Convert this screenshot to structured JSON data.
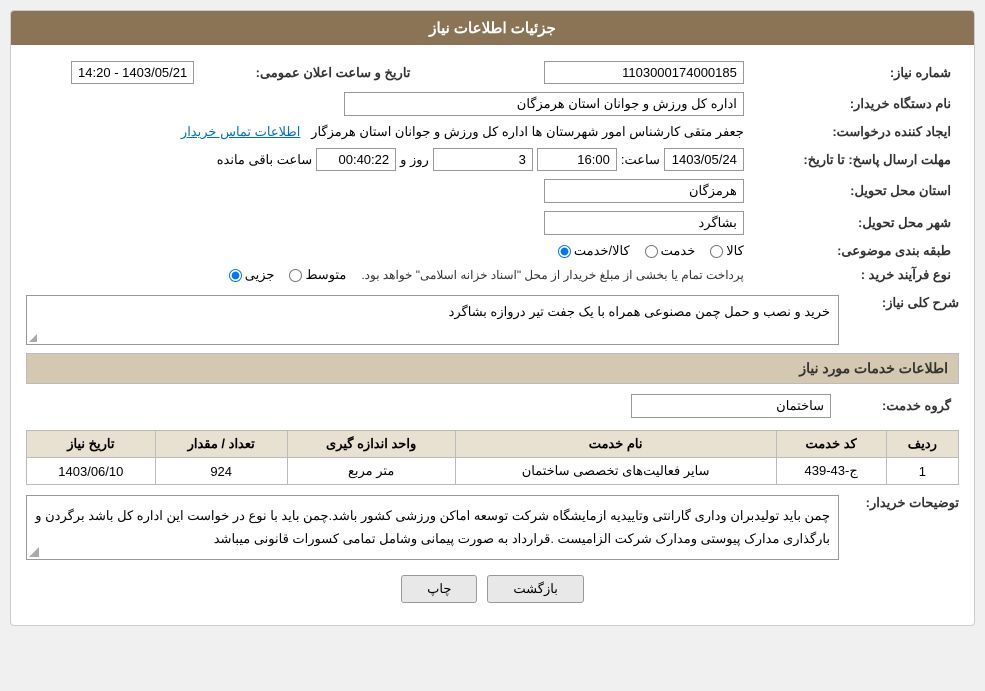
{
  "header": {
    "title": "جزئیات اطلاعات نیاز"
  },
  "fields": {
    "shomareNiaz_label": "شماره نیاز:",
    "shomareNiaz_value": "1103000174000185",
    "namDastgah_label": "نام دستگاه خریدار:",
    "namDastgah_value": "اداره کل ورزش و جوانان استان هرمزگان",
    "ijadKonande_label": "ایجاد کننده درخواست:",
    "ijadKonande_value": "جعفر متقی کارشناس امور شهرستان ها اداره کل ورزش و جوانان استان هرمزگار",
    "ettelaat_link": "اطلاعات تماس خریدار",
    "mohlat_label": "مهلت ارسال پاسخ: تا تاریخ:",
    "mohlat_date": "1403/05/24",
    "mohlat_saat_label": "ساعت:",
    "mohlat_saat": "16:00",
    "mohlat_roz_label": "روز و",
    "mohlat_roz": "3",
    "mohlat_baqi_label": "ساعت باقی مانده",
    "mohlat_baqi": "00:40:22",
    "ostan_label": "استان محل تحویل:",
    "ostan_value": "هرمزگان",
    "shahr_label": "شهر محل تحویل:",
    "shahr_value": "بشاگرد",
    "tabaqe_label": "طبقه بندی موضوعی:",
    "tabaqe_kala": "کالا",
    "tabaqe_khadamat": "خدمت",
    "tabaqe_kala_khadamat": "کالا/خدمت",
    "noe_farayand_label": "نوع فرآیند خرید :",
    "noe_jozi": "جزیی",
    "noe_motevaset": "متوسط",
    "noe_desc": "پرداخت تمام یا بخشی از مبلغ خریدار از محل \"اسناد خزانه اسلامی\" خواهد بود.",
    "sharh_label": "شرح کلی نیاز:",
    "sharh_value": "خرید و نصب و حمل چمن مصنوعی همراه با یک جفت تیر دروازه بشاگرد",
    "section_khadamat": "اطلاعات خدمات مورد نیاز",
    "grohe_khadamat_label": "گروه خدمت:",
    "grohe_khadamat_value": "ساختمان",
    "table_headers": {
      "radif": "ردیف",
      "kod": "کد خدمت",
      "name": "نام خدمت",
      "vahad": "واحد اندازه گیری",
      "tedad": "تعداد / مقدار",
      "tarikh": "تاریخ نیاز"
    },
    "table_rows": [
      {
        "radif": "1",
        "kod": "ج-43-439",
        "name": "سایر فعالیت‌های تخصصی ساختمان",
        "vahad": "متر مربع",
        "tedad": "924",
        "tarikh": "1403/06/10"
      }
    ],
    "توضیحات_label": "توضیحات خریدار:",
    "توضیحات_value": "چمن باید تولیدبران وداری گارانتی وتاییدیه ازمایشگاه شرکت توسعه اماکن ورزشی کشور باشد.چمن باید با نوع در خواست این اداره کل باشد برگردن و بارگذاری مدارک پیوستی  ومدارک شرکت الزامیست .قرارداد به صورت پیمانی وشامل تمامی کسورات قانونی میباشد",
    "btn_back": "بازگشت",
    "btn_print": "چاپ"
  },
  "tarikhe_aalan": "تاریخ و ساعت اعلان عمومی:",
  "tarikhe_aalan_value": "1403/05/21 - 14:20"
}
